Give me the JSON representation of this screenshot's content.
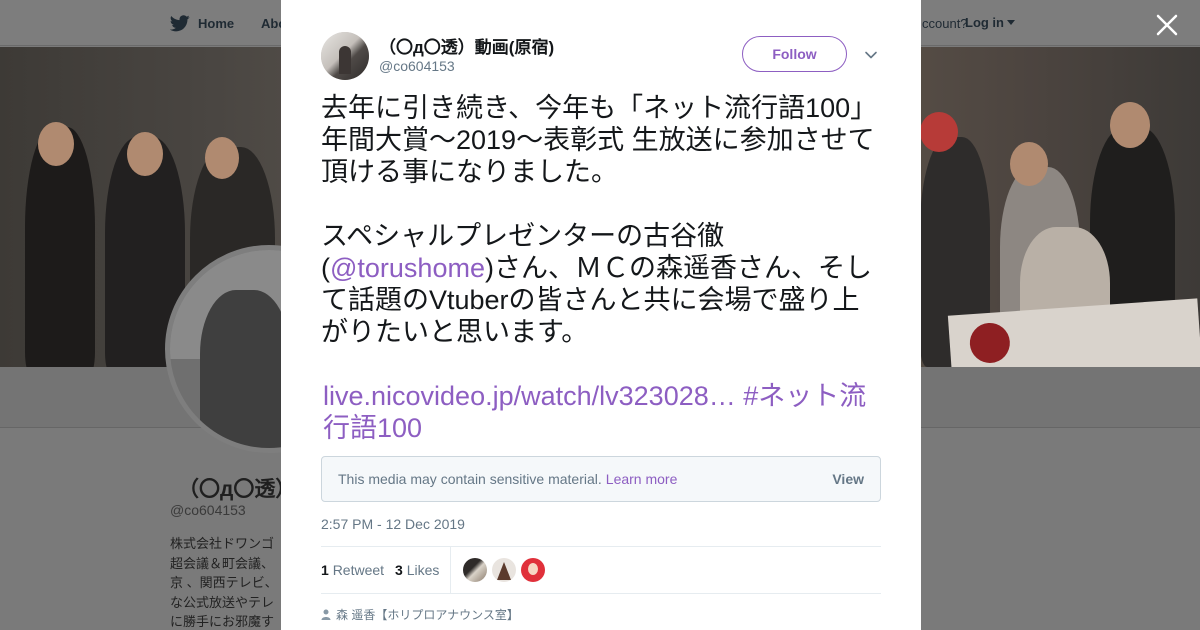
{
  "topnav": {
    "home_label": "Home",
    "about_label": "Abo",
    "account_text": "ccount?",
    "login_label": "Log in"
  },
  "profile": {
    "name_partial": "（〇д〇透）",
    "handle": "@co604153",
    "bio_lines": [
      "株式会社ドワンゴ",
      "超会議＆町会議、",
      "京 、関西テレビ、",
      "な公式放送やテレ",
      "に勝手にお邪魔す"
    ]
  },
  "tweet": {
    "author_name": "（〇д〇透）動画(原宿)",
    "author_handle": "@co604153",
    "follow_label": "Follow",
    "text_p1": "去年に引き続き、今年も「ネット流行語100」年間大賞～2019～表彰式 生放送に参加させて頂ける事になりました。",
    "text_p2_pre": "スペシャルプレゼンターの古谷徹(",
    "text_p2_mention": "@torushome",
    "text_p2_post": ")さん、ＭＣの森遥香さん、そして話題のVtuberの皆さんと共に会場で盛り上がりたいと思います。",
    "link_url": "live.nicovideo.jp/watch/lv323028…",
    "hashtag": "#ネット流行語100",
    "sensitive_msg": "This media may contain sensitive material.",
    "learn_more": "Learn more",
    "view_label": "View",
    "timestamp": "2:57 PM - 12 Dec 2019",
    "retweets_count": "1",
    "retweets_label": "Retweet",
    "likes_count": "3",
    "likes_label": "Likes",
    "reply_context": "森 遥香【ホリプロアナウンス室】"
  },
  "colors": {
    "accent": "#8d5ec2",
    "text": "#14171a",
    "muted": "#657786"
  }
}
